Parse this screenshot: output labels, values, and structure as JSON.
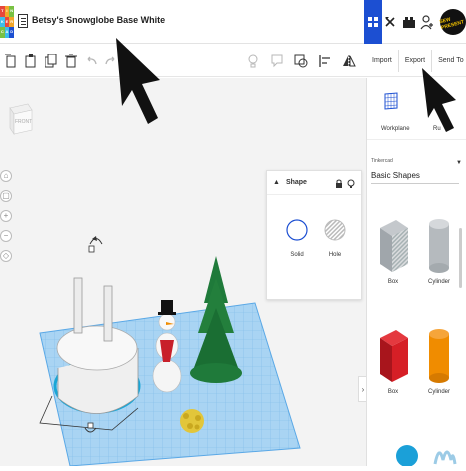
{
  "app": {
    "logo_letters": [
      "T",
      "I",
      "N",
      "K",
      "E",
      "R",
      "C",
      "A",
      "D"
    ],
    "logo_colors": [
      "#e7473c",
      "#f3a629",
      "#79c143",
      "#3dbde9",
      "#e7473c",
      "#f3a629",
      "#79c143",
      "#3dbde9",
      "#1c4fd2"
    ],
    "title": "Betsy's Snowglobe Base White",
    "avatar_text": "SEW PRESENT"
  },
  "actions": {
    "import": "Import",
    "export": "Export",
    "send_to": "Send To"
  },
  "viewcube": {
    "face": "FRONT"
  },
  "shape_panel": {
    "title": "Shape",
    "solid": "Solid",
    "hole": "Hole"
  },
  "workplane_panel": {
    "workplane": "Workplane",
    "ruler": "Ru"
  },
  "library": {
    "source": "Tinkercad",
    "category": "Basic Shapes",
    "items": [
      "Box",
      "Cylinder",
      "Box",
      "Cylinder"
    ]
  },
  "colors": {
    "accent_blue": "#1c4fd2",
    "grid_blue": "#5aa8e6",
    "box_red": "#d61f26",
    "cylinder_orange": "#f08c00",
    "tree_green": "#1f7a3a",
    "snow_white": "#f5f5f5"
  }
}
